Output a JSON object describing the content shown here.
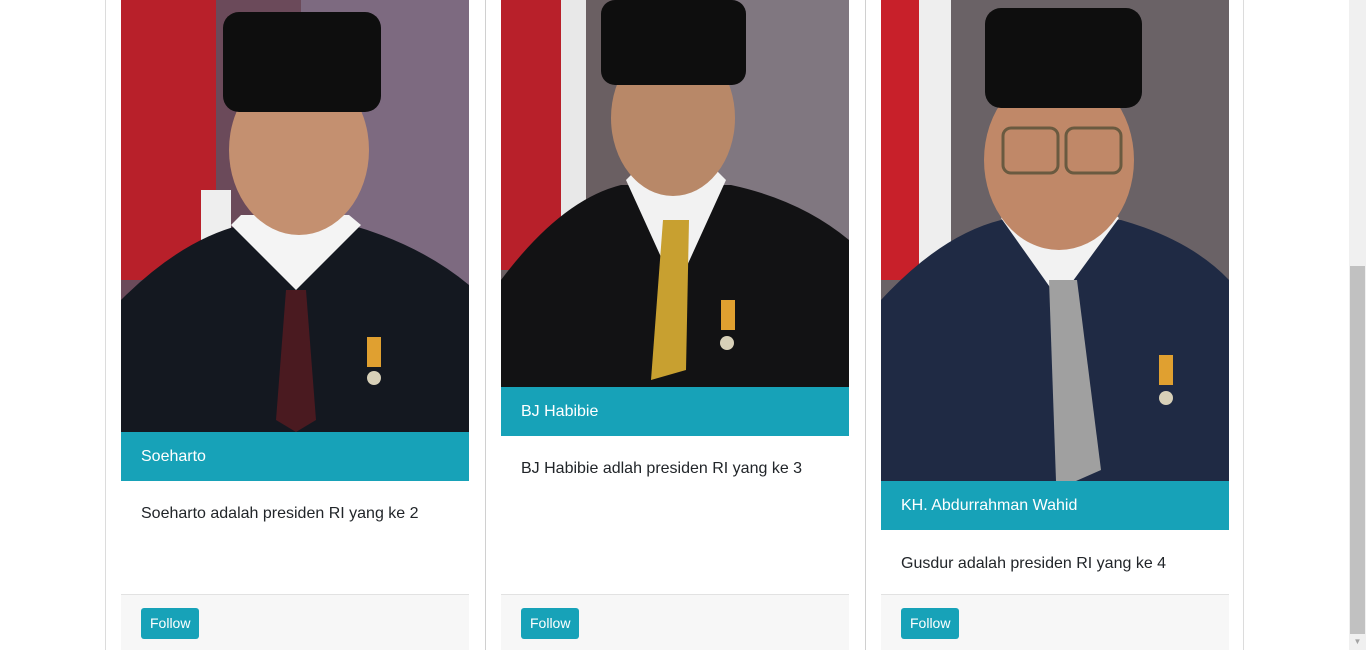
{
  "cards": [
    {
      "name": "Soeharto",
      "description": "Soeharto adalah presiden RI yang ke 2",
      "follow_label": "Follow"
    },
    {
      "name": "BJ Habibie",
      "description": "BJ Habibie adlah presiden RI yang ke 3",
      "follow_label": "Follow"
    },
    {
      "name": "KH. Abdurrahman Wahid",
      "description": "Gusdur adalah presiden RI yang ke 4",
      "follow_label": "Follow"
    }
  ],
  "colors": {
    "accent": "#17a2b8",
    "footer_bg": "#f7f7f7",
    "text": "#212529"
  },
  "icons": {
    "scroll_down": "scroll-down-arrow-icon"
  }
}
